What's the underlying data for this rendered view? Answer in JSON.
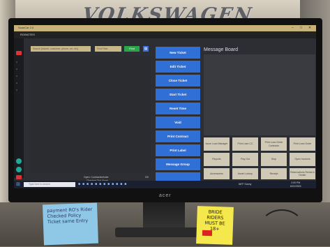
{
  "environment": {
    "wall_sign": "VOLKSWAGEN",
    "monitor_brand": "acer"
  },
  "app": {
    "window_title": "ScanCar 2.0",
    "app_name": "RO/NOTES"
  },
  "search": {
    "placeholder": "Search [ticket#, customer, phone, vin, etc]",
    "field_select": "Find Field",
    "find_label": "Find"
  },
  "ticket_panel": {
    "status_line1": "Open: Contracted/Late",
    "status_line2": "Checked Out: None",
    "count": "0/0"
  },
  "actions": [
    {
      "label": "New Ticket"
    },
    {
      "label": "Edit Ticket"
    },
    {
      "label": "Close Ticket"
    },
    {
      "label": "Start Ticket"
    },
    {
      "label": "Reset Time"
    },
    {
      "label": "Void"
    },
    {
      "label": "Print Contract"
    },
    {
      "label": "Print Label"
    },
    {
      "label": "Message Group"
    }
  ],
  "message_board": {
    "title": "Message Board"
  },
  "grid_buttons": [
    {
      "label": "Issue Loan Manager"
    },
    {
      "label": "Print Loan CC"
    },
    {
      "label": "Print Loan Order Contracts"
    },
    {
      "label": "Print Loan Order"
    },
    {
      "label": "Reports"
    },
    {
      "label": "Pay Out"
    },
    {
      "label": "Stop"
    },
    {
      "label": "Open Invoices"
    },
    {
      "label": "Accessories"
    },
    {
      "label": "Asset Lookup"
    },
    {
      "label": "Receipt"
    },
    {
      "label": "Reservations Rental & Dealer"
    }
  ],
  "taskbar": {
    "search_placeholder": "Type here to search",
    "weather": "66°F Sunny",
    "time": "2:00 PM",
    "date": "6/21/2024"
  },
  "notes": {
    "blue_note": "payment RO's Rider Checked Policy Ticket same Entry",
    "yellow_note": "BRIDE RIDERS MUST BE 18+"
  }
}
